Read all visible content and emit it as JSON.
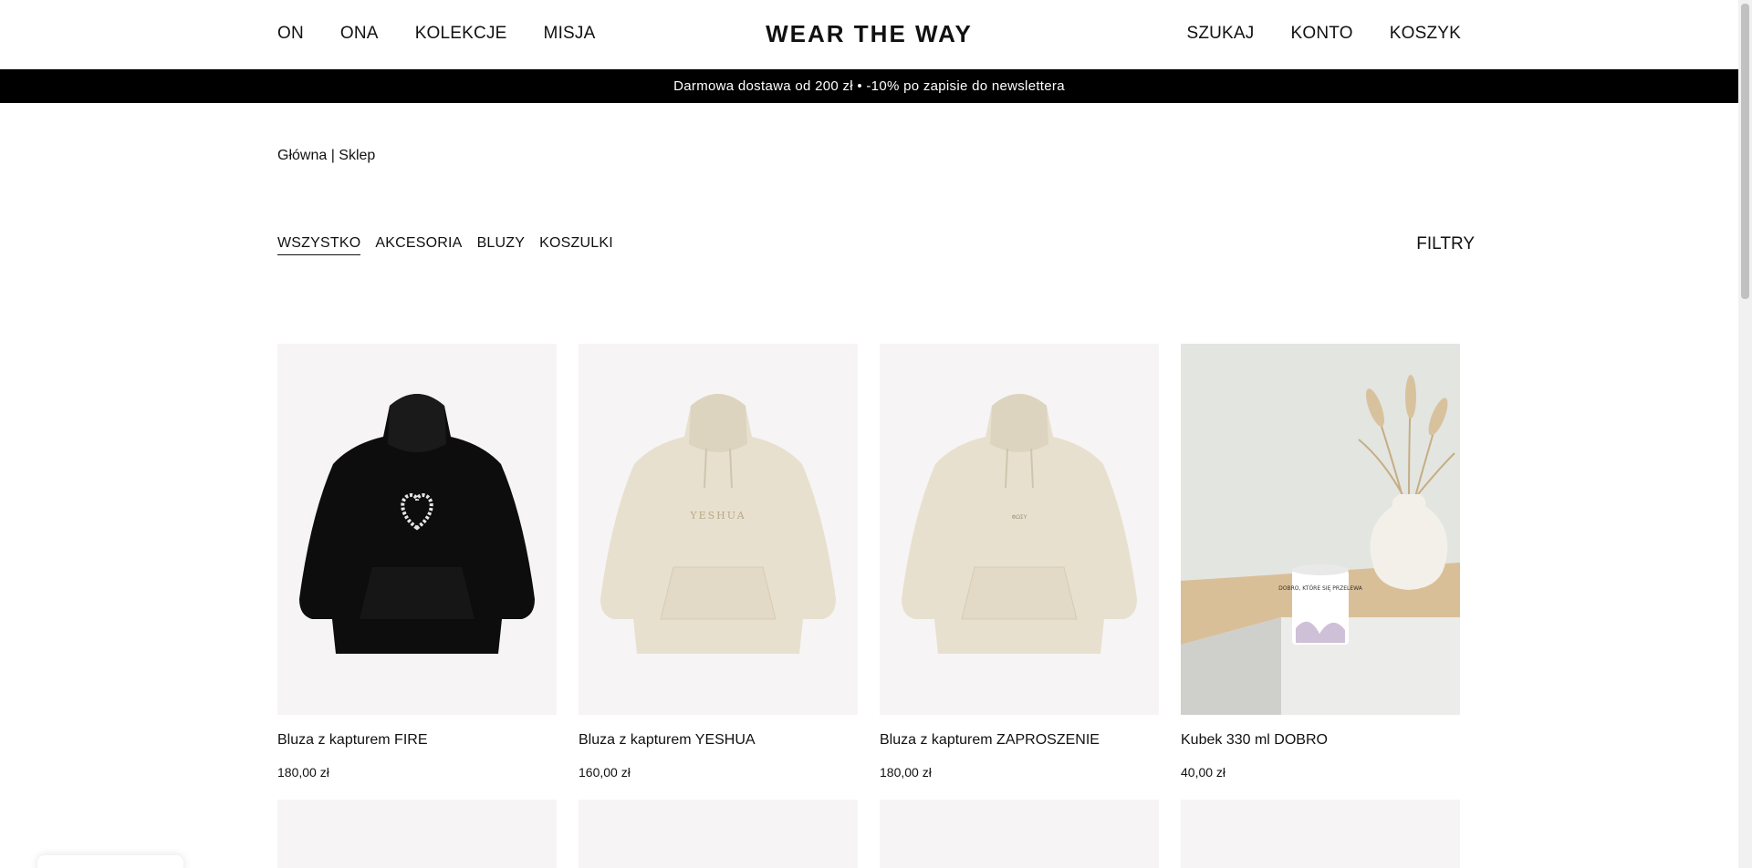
{
  "header": {
    "nav_left": [
      "ON",
      "ONA",
      "KOLEKCJE",
      "MISJA"
    ],
    "logo": "WEAR THE WAY",
    "nav_right": [
      "SZUKAJ",
      "KONTO",
      "KOSZYK"
    ]
  },
  "promo": "Darmowa dostawa od 200 zł • -10% po zapisie do newslettera",
  "breadcrumb": {
    "home": "Główna",
    "separator": " | ",
    "current": "Sklep"
  },
  "categories": [
    "WSZYSTKO",
    "AKCESORIA",
    "BLUZY",
    "KOSZULKI"
  ],
  "active_category": "WSZYSTKO",
  "filters_label": "FILTRY",
  "products": [
    {
      "name": "Bluza z kapturem FIRE",
      "price": "180,00 zł",
      "image": "black-hoodie-heart"
    },
    {
      "name": "Bluza z kapturem YESHUA",
      "price": "160,00 zł",
      "image": "beige-hoodie-yeshua",
      "print": "YESHUA"
    },
    {
      "name": "Bluza z kapturem ZAPROSZENIE",
      "price": "180,00 zł",
      "image": "beige-hoodie-small-print",
      "print": "ΦΩΣΥ"
    },
    {
      "name": "Kubek 330 ml DOBRO",
      "price": "40,00 zł",
      "image": "mug-on-table",
      "print": "DOBRO, KTÓRE SIĘ PRZELEWA"
    }
  ],
  "colors": {
    "promo_bg": "#000000",
    "card_bg": "#f6f4f4",
    "hoodie_black": "#0d0d0d",
    "hoodie_beige": "#e8e0cf"
  }
}
